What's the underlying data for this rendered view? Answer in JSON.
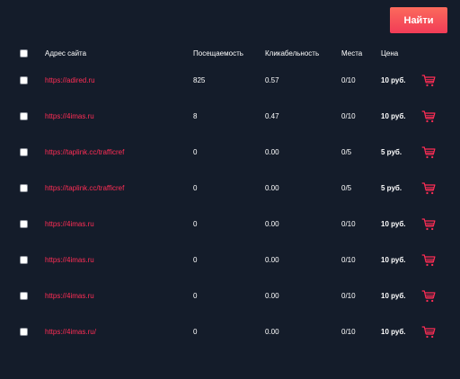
{
  "search_button": {
    "label": "Найти"
  },
  "table": {
    "headers": {
      "site": "Адрес сайта",
      "traffic": "Посещаемость",
      "ctr": "Кликабельность",
      "places": "Места",
      "price": "Цена"
    },
    "rows": [
      {
        "url": "https://adired.ru",
        "traffic": "825",
        "ctr": "0.57",
        "places": "0/10",
        "price": "10 руб."
      },
      {
        "url": "https://4imas.ru",
        "traffic": "8",
        "ctr": "0.47",
        "places": "0/10",
        "price": "10 руб."
      },
      {
        "url": "https://taplink.cc/trafficref",
        "traffic": "0",
        "ctr": "0.00",
        "places": "0/5",
        "price": "5 руб."
      },
      {
        "url": "https://taplink.cc/trafficref",
        "traffic": "0",
        "ctr": "0.00",
        "places": "0/5",
        "price": "5 руб."
      },
      {
        "url": "https://4imas.ru",
        "traffic": "0",
        "ctr": "0.00",
        "places": "0/10",
        "price": "10 руб."
      },
      {
        "url": "https://4imas.ru",
        "traffic": "0",
        "ctr": "0.00",
        "places": "0/10",
        "price": "10 руб."
      },
      {
        "url": "https://4imas.ru",
        "traffic": "0",
        "ctr": "0.00",
        "places": "0/10",
        "price": "10 руб."
      },
      {
        "url": "https://4imas.ru/",
        "traffic": "0",
        "ctr": "0.00",
        "places": "0/10",
        "price": "10 руб."
      }
    ]
  },
  "colors": {
    "background": "#141c2a",
    "link": "#ff2d55",
    "accent": "#f23c57",
    "cart_icon": "#ff2d55"
  },
  "icons": {
    "row_action": "shopping-cart-icon"
  }
}
